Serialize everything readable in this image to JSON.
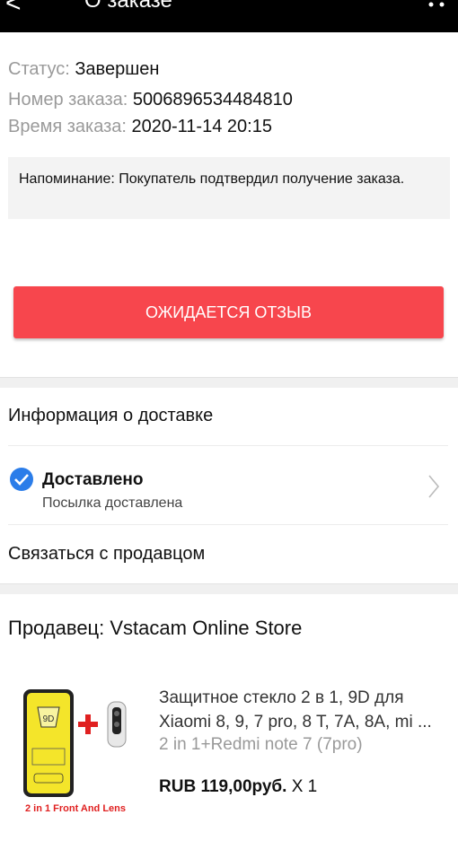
{
  "topbar": {
    "back": "<",
    "title": "О заказе"
  },
  "order": {
    "status_label": "Статус:",
    "status_value": "Завершен",
    "number_label": "Номер заказа:",
    "number_value": "5006896534484810",
    "time_label": "Время заказа:",
    "time_value": "2020-11-14 20:15"
  },
  "reminder": "Напоминание: Покупатель подтвердил получение заказа.",
  "review_button": "ОЖИДАЕТСЯ ОТЗЫВ",
  "delivery": {
    "header": "Информация о доставке",
    "status_title": "Доставлено",
    "status_sub": "Посылка доставлена",
    "contact": "Связаться с продавцом"
  },
  "seller": "Продавец: Vstacam Online Store",
  "product": {
    "title_line1": "Защитное стекло 2 в 1, 9D для",
    "title_line2": "Xiaomi 8, 9, 7 pro, 8 T, 7A, 8A, mi ...",
    "variant": "2 in 1+Redmi note 7 (7pro)",
    "price": "RUB 119,00руб.",
    "qty": "X 1",
    "image_label_9d": "9D",
    "image_caption": "2 in 1 Front And Lens"
  },
  "colors": {
    "accent": "#f7464d",
    "check": "#2b7de9",
    "topbar": "#000000"
  },
  "icons": [
    "back-arrow-icon",
    "headset-icon",
    "cart-icon",
    "check-circle-icon",
    "chevron-right-icon"
  ]
}
